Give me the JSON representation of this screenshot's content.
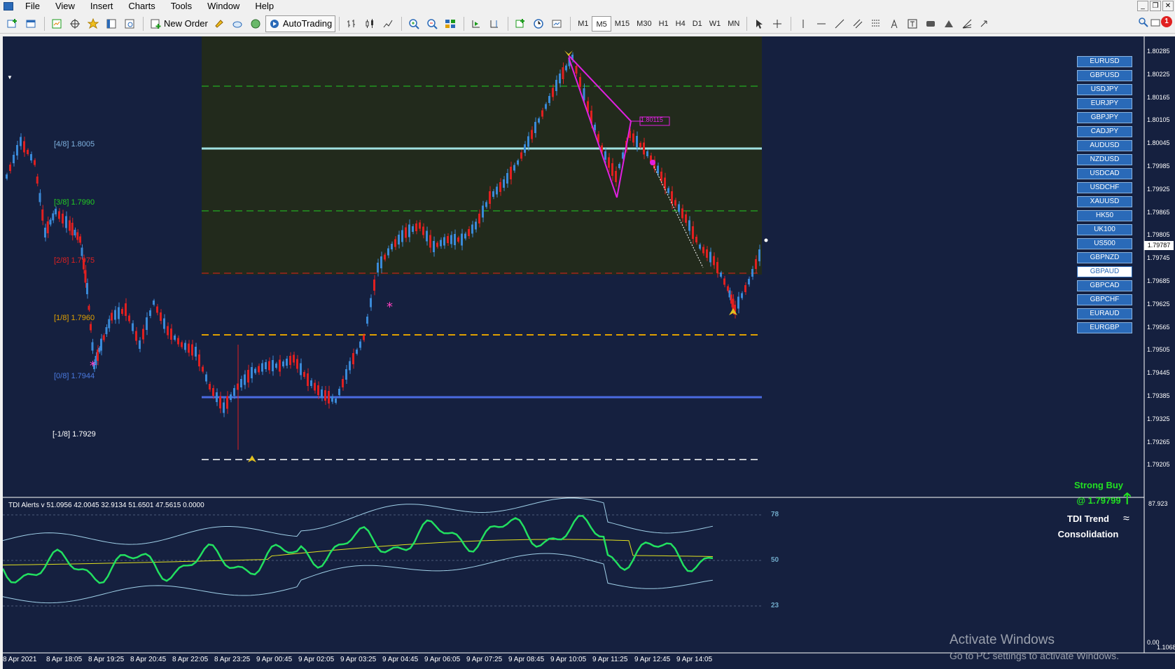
{
  "menu": [
    "File",
    "View",
    "Insert",
    "Charts",
    "Tools",
    "Window",
    "Help"
  ],
  "window_controls": [
    "_",
    "❐",
    "✕"
  ],
  "toolbar": {
    "new_order": "New Order",
    "autotrading": "AutoTrading",
    "timeframes": [
      "M1",
      "M5",
      "M15",
      "M30",
      "H1",
      "H4",
      "D1",
      "W1",
      "MN"
    ],
    "active_timeframe": "M5",
    "alert_count": "1"
  },
  "symbols": [
    "EURUSD",
    "GBPUSD",
    "USDJPY",
    "EURJPY",
    "GBPJPY",
    "CADJPY",
    "AUDUSD",
    "NZDUSD",
    "USDCAD",
    "USDCHF",
    "XAUUSD",
    "HK50",
    "UK100",
    "US500",
    "GBPNZD",
    "GBPAUD",
    "GBPCAD",
    "GBPCHF",
    "EURAUD",
    "EURGBP"
  ],
  "selected_symbol": "GBPAUD",
  "price_axis": [
    "1.80285",
    "1.80225",
    "1.80165",
    "1.80105",
    "1.80045",
    "1.79985",
    "1.79925",
    "1.79865",
    "1.79805",
    "1.79745",
    "1.79685",
    "1.79625",
    "1.79565",
    "1.79505",
    "1.79445",
    "1.79385",
    "1.79325",
    "1.79265",
    "1.79205"
  ],
  "current_price": "1.79787",
  "time_axis": [
    "8 Apr 2021",
    "8 Apr 18:05",
    "8 Apr 19:25",
    "8 Apr 20:45",
    "8 Apr 22:05",
    "8 Apr 23:25",
    "9 Apr 00:45",
    "9 Apr 02:05",
    "9 Apr 03:25",
    "9 Apr 04:45",
    "9 Apr 06:05",
    "9 Apr 07:25",
    "9 Apr 08:45",
    "9 Apr 10:05",
    "9 Apr 11:25",
    "9 Apr 12:45",
    "9 Apr 14:05"
  ],
  "murrey_levels": [
    {
      "label": "[4/8]",
      "value": "1.8005",
      "color": "#7fb2e0"
    },
    {
      "label": "[3/8]",
      "value": "1.7990",
      "color": "#22cc22"
    },
    {
      "label": "[2/8]",
      "value": "1.7975",
      "color": "#e02020"
    },
    {
      "label": "[1/8]",
      "value": "1.7960",
      "color": "#e0a000"
    },
    {
      "label": "[0/8]",
      "value": "1.7944",
      "color": "#4a7ae0"
    },
    {
      "label": "[-1/8]",
      "value": "1.7929",
      "color": "#ffffff"
    }
  ],
  "pattern_label": "1.80115",
  "indicator": {
    "header": "TDI Alerts v 51.0956 42.0045 32.9134 51.6501 47.5615 0.0000",
    "levels": [
      "78",
      "50",
      "23"
    ],
    "scale_top": "87.923",
    "scale_bottom": "0.00",
    "signal_title": "Strong Buy",
    "signal_price": "@ 1.79799",
    "trend_title": "TDI Trend",
    "trend_state": "Consolidation"
  },
  "price_axis_bottom": "1.1068",
  "watermark": {
    "title": "Activate Windows",
    "subtitle": "Go to PC settings to activate Windows."
  },
  "colors": {
    "chart_bg": "#15203f",
    "zone_bg": "#222a1c",
    "bull": "#3a8ad8",
    "bear": "#e02020",
    "tdi_green": "#22e060",
    "tdi_yellow": "#e0e020",
    "tdi_band": "#a0d0e8",
    "pattern": "#e020e0"
  }
}
